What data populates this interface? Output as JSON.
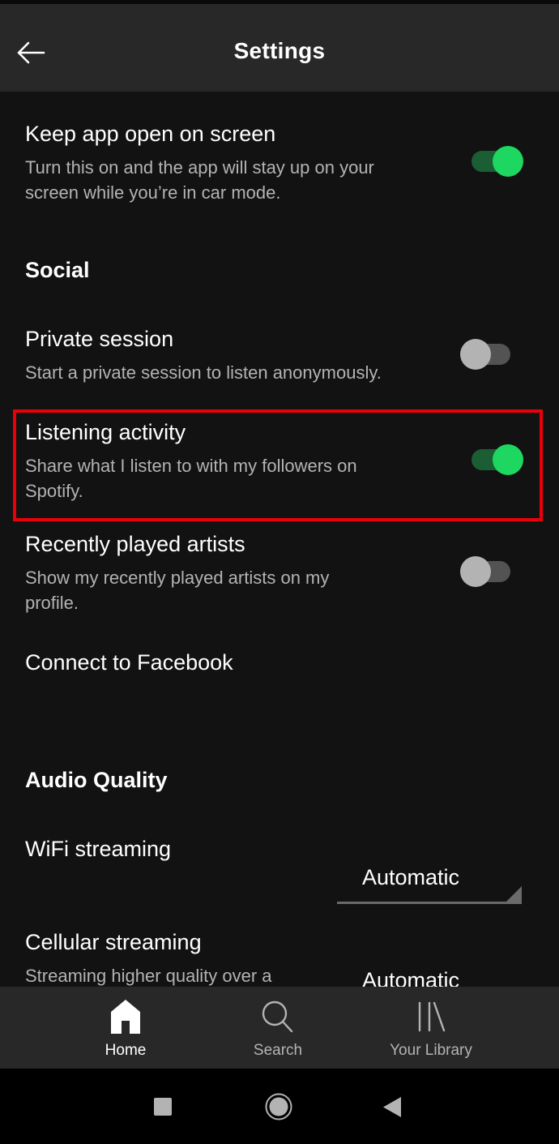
{
  "header": {
    "title": "Settings",
    "back_icon": "arrow-left-icon"
  },
  "settings": {
    "keep_app_open": {
      "title": "Keep app open on screen",
      "subtitle_lines": [
        "Turn this on and the app will stay up on your",
        "screen while you’re in car mode."
      ],
      "enabled": true
    },
    "social_section": "Social",
    "private_session": {
      "title": "Private session",
      "subtitle_lines": [
        "Start a private session to listen anonymously."
      ],
      "enabled": false
    },
    "listening_activity": {
      "title": "Listening activity",
      "subtitle_lines": [
        "Share what I listen to with my followers on",
        "Spotify."
      ],
      "enabled": true,
      "highlighted": true
    },
    "recently_played_artists": {
      "title": "Recently played artists",
      "subtitle_lines": [
        "Show my recently played artists on my",
        "profile."
      ],
      "enabled": false
    },
    "connect_facebook": {
      "title": "Connect to Facebook"
    },
    "audio_quality_section": "Audio Quality",
    "wifi_streaming": {
      "title": "WiFi streaming",
      "value": "Automatic"
    },
    "cellular_streaming": {
      "title": "Cellular streaming",
      "subtitle_lines": [
        "Streaming higher quality over a"
      ],
      "value": "Automatic"
    }
  },
  "bottom_nav": {
    "items": [
      {
        "label": "Home",
        "icon": "home-icon",
        "active": true
      },
      {
        "label": "Search",
        "icon": "search-icon",
        "active": false
      },
      {
        "label": "Your Library",
        "icon": "library-icon",
        "active": false
      }
    ]
  },
  "system_nav": {
    "buttons": [
      "recents-icon",
      "home-circle-icon",
      "back-triangle-icon"
    ]
  },
  "colors": {
    "accent_green": "#1ed760",
    "highlight_red": "#e8000b",
    "header_bg": "#282828",
    "body_bg": "#121212"
  }
}
